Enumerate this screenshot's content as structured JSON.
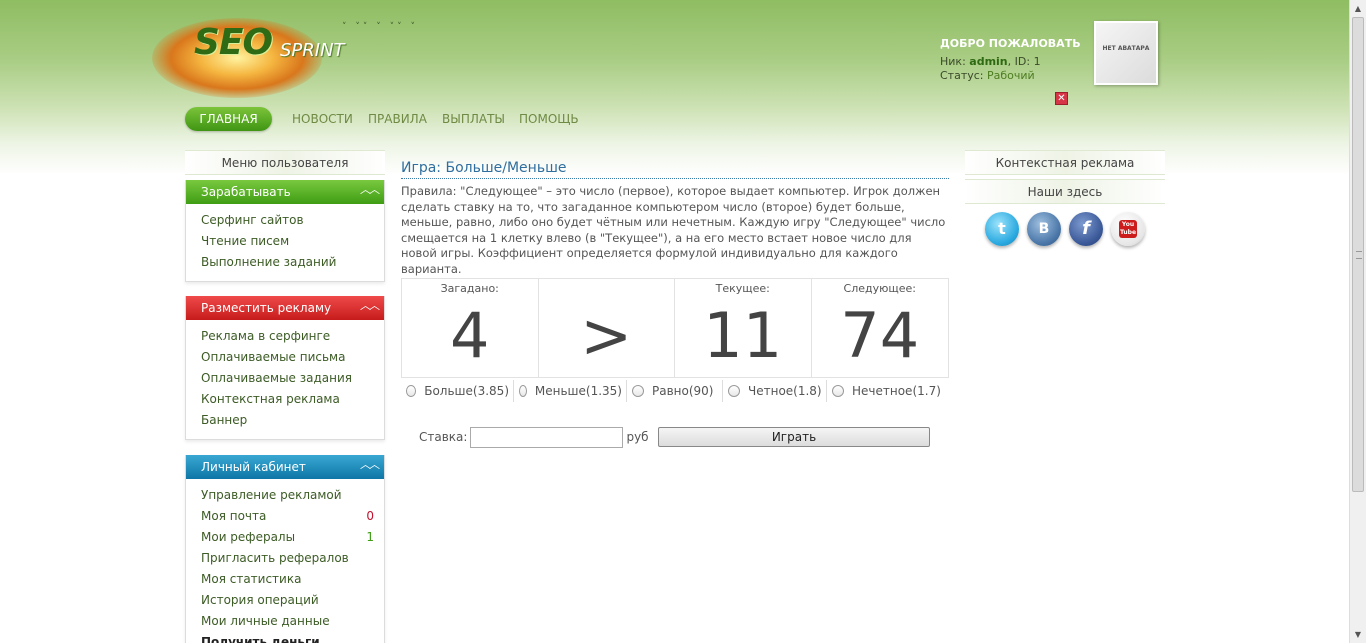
{
  "header": {
    "logo_main": "SEO",
    "logo_sub": "SPRINT",
    "welcome_title": "ДОБРО ПОЖАЛОВАТЬ",
    "nick_label": "Ник: ",
    "nick_value": "admin",
    "id_label": ", ID: ",
    "id_value": "1",
    "status_label": "Статус: ",
    "status_value": "Рабочий",
    "avatar_text": "НЕТ АВАТАРА",
    "close_glyph": "✕"
  },
  "nav": {
    "home": "ГЛАВНАЯ",
    "news": "НОВОСТИ",
    "rules": "ПРАВИЛА",
    "payouts": "ВЫПЛАТЫ",
    "help": "ПОМОЩЬ"
  },
  "left": {
    "title": "Меню пользователя",
    "chev": "︿︿",
    "earn": {
      "title": "Зарабатывать",
      "items": [
        "Серфинг сайтов",
        "Чтение писем",
        "Выполнение заданий"
      ]
    },
    "advertise": {
      "title": "Разместить рекламу",
      "items": [
        "Реклама в серфинге",
        "Оплачиваемые письма",
        "Оплачиваемые задания",
        "Контекстная реклама",
        "Баннер"
      ]
    },
    "cabinet": {
      "title": "Личный кабинет",
      "items": [
        "Управление рекламой",
        "Моя почта",
        "Мои рефералы",
        "Пригласить рефералов",
        "Моя статистика",
        "История операций",
        "Мои личные данные",
        "Получить деньги"
      ],
      "mail_count": "0",
      "ref_count": "1"
    }
  },
  "game": {
    "title": "Игра: Больше/Меньше",
    "rules": "Правила: \"Следующее\" – это число (первое), которое выдает компьютер. Игрок должен сделать ставку на то, что загаданное компьютером число (второе) будет больше, меньше, равно, либо оно будет чётным или нечетным. Каждую игру \"Следующее\" число смещается на 1 клетку влево (в \"Текущее\"), а на его место встает новое число для новой игры. Коэффициент определяется формулой индивидуально для каждого варианта.",
    "cells": [
      {
        "label": "Загадано:",
        "value": "4"
      },
      {
        "label": "",
        "value": ">"
      },
      {
        "label": "Текущее:",
        "value": "11"
      },
      {
        "label": "Следующее:",
        "value": "74"
      }
    ],
    "options": [
      "Больше(3.85)",
      "Меньше(1.35)",
      "Равно(90)",
      "Четное(1.8)",
      "Нечетное(1.7)"
    ],
    "bet_label": "Ставка:",
    "bet_value": "",
    "currency": "руб",
    "play_button": "Играть"
  },
  "right": {
    "ads_title": "Контекстная реклама",
    "here_title": "Наши здесь",
    "socials": {
      "twitter": "t",
      "vk": "B",
      "facebook": "f",
      "youtube": "You Tube"
    }
  },
  "icons": {
    "scroll_up": "▲",
    "scroll_down": "▼"
  }
}
